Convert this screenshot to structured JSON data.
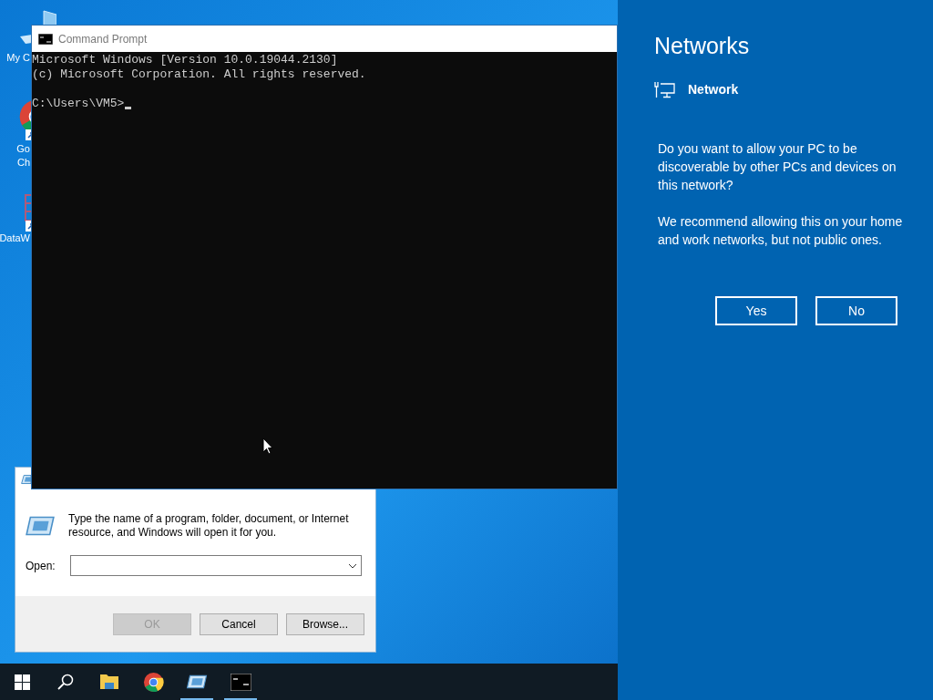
{
  "desktop_icons": [
    {
      "kind": "computer",
      "label": "My C"
    },
    {
      "kind": "chrome",
      "label": "Go\nCh"
    },
    {
      "kind": "grid",
      "label": "DataW"
    }
  ],
  "run_dialog": {
    "message": "Type the name of a program, folder, document, or Internet resource, and Windows will open it for you.",
    "open_label": "Open:",
    "buttons": [
      {
        "label": "OK",
        "disabled": true
      },
      {
        "label": "Cancel",
        "disabled": false
      },
      {
        "label": "Browse...",
        "disabled": false
      }
    ]
  },
  "command_prompt": {
    "title": "Command Prompt",
    "lines": [
      "Microsoft Windows [Version 10.0.19044.2130]",
      "(c) Microsoft Corporation. All rights reserved."
    ],
    "prompt": "C:\\Users\\VM5>"
  },
  "taskbar": [
    {
      "kind": "start",
      "open": false
    },
    {
      "kind": "search",
      "open": false
    },
    {
      "kind": "folder",
      "open": false
    },
    {
      "kind": "chrome",
      "open": false
    },
    {
      "kind": "run",
      "open": true
    },
    {
      "kind": "cmd",
      "open": true
    }
  ],
  "networks_panel": {
    "title": "Networks",
    "network": "Network",
    "paragraphs": [
      "Do you want to allow your PC to be discoverable by other PCs and devices on this network?",
      "We recommend allowing this on your home and work networks, but not public ones."
    ],
    "buttons": [
      "Yes",
      "No"
    ]
  }
}
